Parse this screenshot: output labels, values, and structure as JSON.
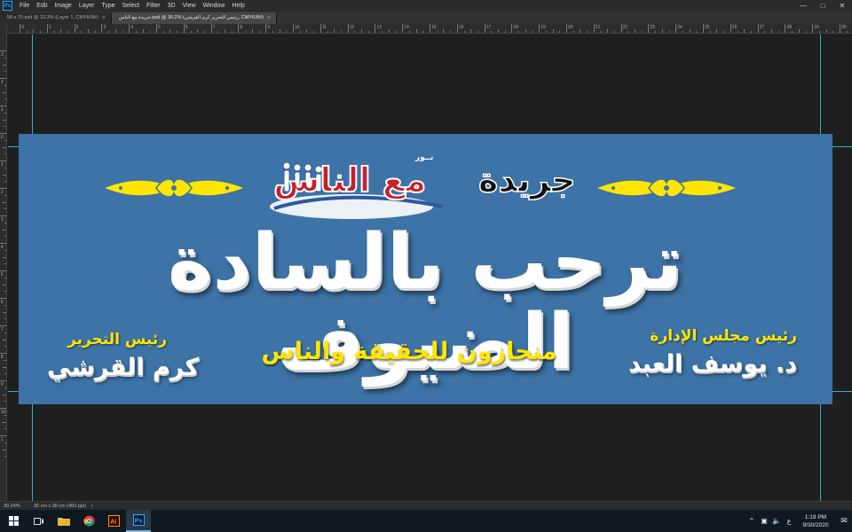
{
  "menu": {
    "items": [
      "File",
      "Edit",
      "Image",
      "Layer",
      "Type",
      "Select",
      "Filter",
      "3D",
      "View",
      "Window",
      "Help"
    ]
  },
  "tabs": [
    {
      "label": "58 x 70.psd @ 33.3% (Layer 1, CMYK/8#)",
      "active": false
    },
    {
      "label": "جريدة مع الناس.psd @ 30.2% (رئيس التحرير كرم القرشي, CMYK/8#)",
      "active": true
    }
  ],
  "ruler": {
    "h_labels": [
      "0",
      "1",
      "2",
      "3",
      "4",
      "5",
      "6",
      "7",
      "8",
      "9",
      "10",
      "11",
      "12",
      "13",
      "14",
      "15",
      "16",
      "17",
      "18",
      "19",
      "20",
      "21",
      "22",
      "23",
      "24",
      "25",
      "26",
      "27",
      "28",
      "29",
      "30"
    ],
    "v_labels": [
      "3",
      "2",
      "1",
      "0",
      "1",
      "2",
      "3",
      "4",
      "5",
      "6",
      "7",
      "8",
      "9",
      "10",
      "1"
    ]
  },
  "banner": {
    "paper_label": "جريدة",
    "logo_name": "مع الناس",
    "logo_small": "نــور",
    "headline": "ترحب بالسادة الضيوف",
    "slogan": "منحازون للحقيقة والناس",
    "right_role": "رئيس مجلس الإدارة",
    "right_person": "د. يوسف العبد",
    "left_role": "رئيس التحرير",
    "left_person": "كرم القرشي"
  },
  "status": {
    "zoom": "30.24%",
    "doc_info": "30 cm x 30 cm (450 ppi)"
  },
  "taskbar": {
    "lang": "ع",
    "time": "1:19 PM",
    "date": "9/30/2020"
  },
  "colors": {
    "banner_bg": "#3d73a6",
    "accent_yellow": "#ffe600",
    "logo_red": "#c8202a"
  }
}
